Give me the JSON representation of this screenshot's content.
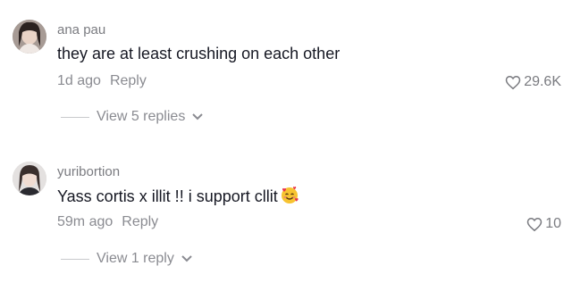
{
  "comments": [
    {
      "username": "ana pau",
      "text": "they are at least crushing on each other",
      "time": "1d ago",
      "reply_label": "Reply",
      "likes": "29.6K",
      "view_replies_label": "View 5 replies"
    },
    {
      "username": "yuribortion",
      "text": "Yass cortis x illit !! i support cllit",
      "emoji": "smiling-face-with-hearts-icon",
      "time": "59m ago",
      "reply_label": "Reply",
      "likes": "10",
      "view_replies_label": "View 1 reply"
    }
  ],
  "colors": {
    "text": "#161823",
    "muted": "#8a8b91",
    "divider": "#c8c9cc"
  }
}
